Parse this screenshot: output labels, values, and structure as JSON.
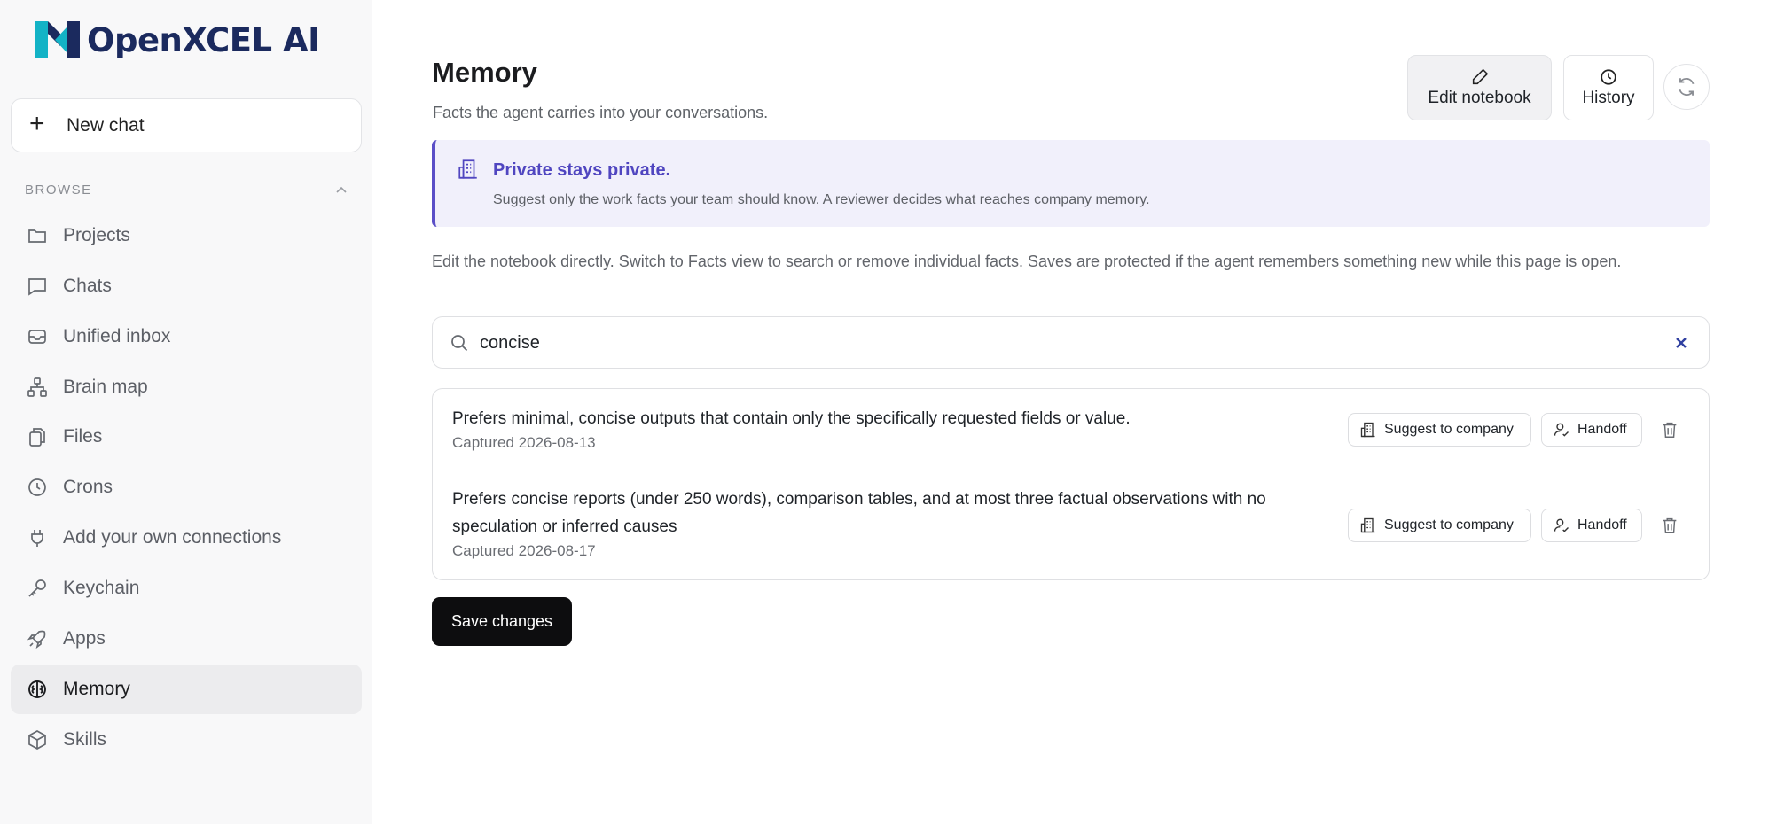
{
  "app": {
    "name": "OpenXCEL AI",
    "brand_colors": {
      "dark": "#1b2a5e",
      "teal": "#13b3c6",
      "accent": "#5046c0"
    }
  },
  "sidebar": {
    "new_chat_label": "New chat",
    "browse_label": "BROWSE",
    "items": [
      {
        "label": "Projects",
        "icon": "folder-icon",
        "active": false
      },
      {
        "label": "Chats",
        "icon": "chat-bubble-icon",
        "active": false
      },
      {
        "label": "Unified inbox",
        "icon": "inbox-icon",
        "active": false
      },
      {
        "label": "Brain map",
        "icon": "sitemap-icon",
        "active": false
      },
      {
        "label": "Files",
        "icon": "files-icon",
        "active": false
      },
      {
        "label": "Crons",
        "icon": "clock-icon",
        "active": false
      },
      {
        "label": "Add your own connections",
        "icon": "plug-icon",
        "active": false
      },
      {
        "label": "Keychain",
        "icon": "key-icon",
        "active": false
      },
      {
        "label": "Apps",
        "icon": "rocket-icon",
        "active": false
      },
      {
        "label": "Memory",
        "icon": "brain-icon",
        "active": true
      },
      {
        "label": "Skills",
        "icon": "cube-icon",
        "active": false
      }
    ]
  },
  "header": {
    "title": "Memory",
    "subtitle": "Facts the agent carries into your conversations.",
    "edit_label": "Edit notebook",
    "history_label": "History"
  },
  "banner": {
    "title": "Private stays private.",
    "text": "Suggest only the work facts your team should know. A reviewer decides what reaches company memory."
  },
  "description": "Edit the notebook directly. Switch to Facts view to search or remove individual facts. Saves are protected if the agent remembers something new while this page is open.",
  "search": {
    "value": "concise",
    "placeholder": "Search facts"
  },
  "facts": [
    {
      "text": "Prefers minimal, concise outputs that contain only the specifically requested fields or value.",
      "captured": "Captured 2026-08-13"
    },
    {
      "text": "Prefers concise reports (under 250 words), comparison tables, and at most three factual observations with no speculation or inferred causes",
      "captured": "Captured 2026-08-17"
    }
  ],
  "actions": {
    "suggest_label": "Suggest to company",
    "handoff_label": "Handoff"
  },
  "save_label": "Save changes"
}
